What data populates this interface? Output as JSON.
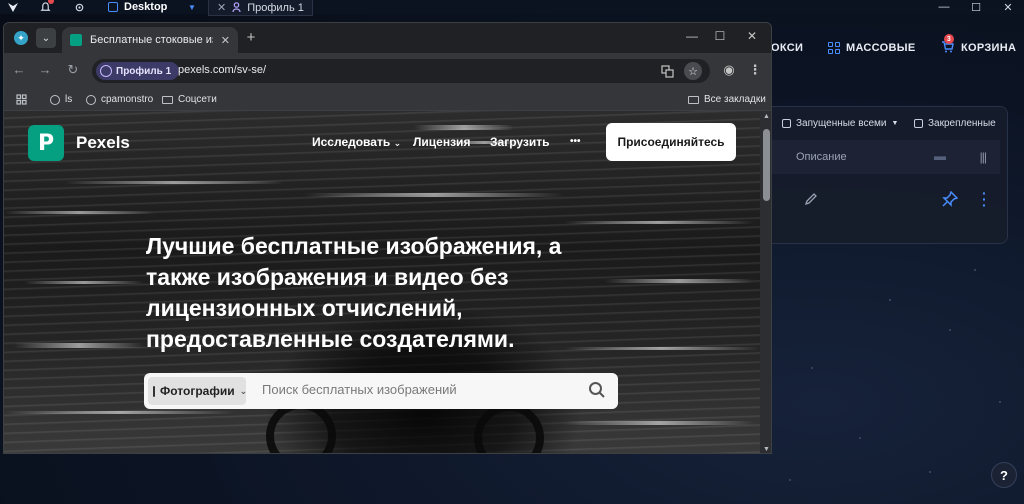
{
  "os_bar": {
    "workspace_label": "Desktop",
    "profile_tab_label": "Профиль 1",
    "window_controls": [
      "—",
      "☐",
      "✕"
    ]
  },
  "background_app": {
    "nav": {
      "proxies_partial": "ОКСИ",
      "bulk": "МАССОВЫЕ",
      "cart": "КОРЗИНА",
      "cart_badge": "3"
    },
    "filters": {
      "running_all": "Запущенные всеми",
      "pinned": "Закрепленные"
    },
    "table_header_description": "Описание",
    "help_label": "?"
  },
  "browser": {
    "tab_title": "Бесплатные стоковые изображения",
    "profile_chip": "Профиль 1",
    "url": "pexels.com/sv-se/",
    "bookmarks": [
      "ls",
      "cpamonstro",
      "Соцсети"
    ],
    "all_bookmarks": "Все закладки"
  },
  "pexels": {
    "brand": "Pexels",
    "nav": {
      "explore": "Исследовать",
      "license": "Лицензия",
      "upload": "Загрузить",
      "more": "•••",
      "join": "Присоединяйтесь"
    },
    "hero_text": "Лучшие бесплатные изображения, а также изображения и видео без лицензионных отчислений, предоставленные создателями.",
    "search": {
      "type": "Фотографии",
      "placeholder": "Поиск бесплатных изображений"
    }
  },
  "colors": {
    "accent_blue": "#4a8dff",
    "pexels_green": "#05a081",
    "badge_red": "#e5484d"
  },
  "icons": [
    "logo-icon",
    "bell-icon",
    "gear-icon",
    "desktop-icon",
    "profile-icon",
    "grid-icon",
    "cart-icon",
    "pencil-icon",
    "pin-icon",
    "kebab-icon",
    "star-icon",
    "translate-icon",
    "search-icon",
    "help-icon"
  ]
}
